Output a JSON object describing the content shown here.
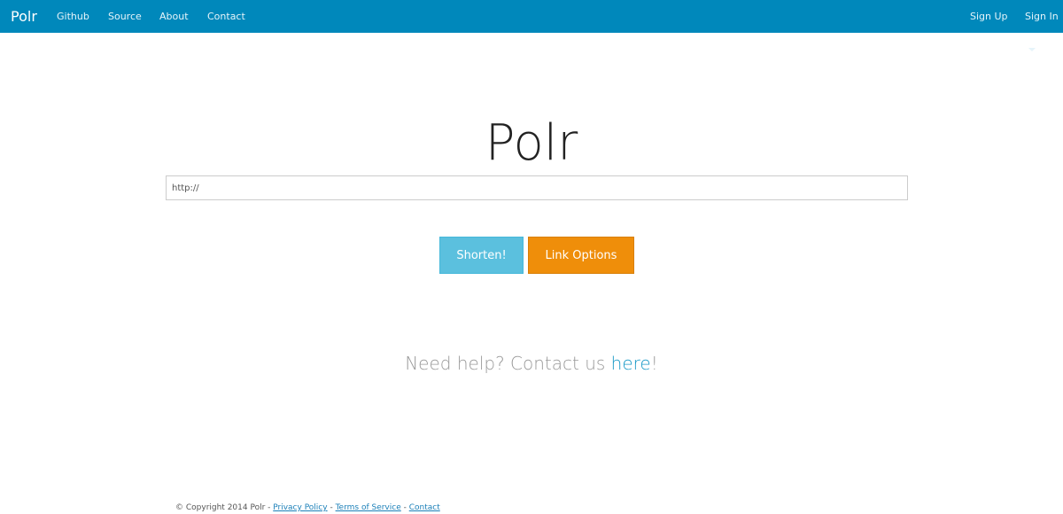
{
  "navbar": {
    "brand": "Polr",
    "links": [
      "Github",
      "Source",
      "About",
      "Contact"
    ],
    "right": {
      "signup": "Sign Up",
      "signin": "Sign In"
    }
  },
  "hero": {
    "title": "Polr"
  },
  "url_input": {
    "value": "http://"
  },
  "buttons": {
    "shorten": "Shorten!",
    "link_options": "Link Options"
  },
  "help": {
    "prefix": "Need help? Contact us ",
    "link": "here",
    "suffix": "!"
  },
  "footer": {
    "copyright": "© Copyright 2014 Polr - ",
    "privacy": "Privacy Policy",
    "sep1": " - ",
    "terms": "Terms of Service",
    "sep2": " - ",
    "contact": "Contact"
  },
  "colors": {
    "navbar_bg": "#0088bb",
    "shorten_bg": "#5bc0de",
    "options_bg": "#ef8e0a"
  }
}
